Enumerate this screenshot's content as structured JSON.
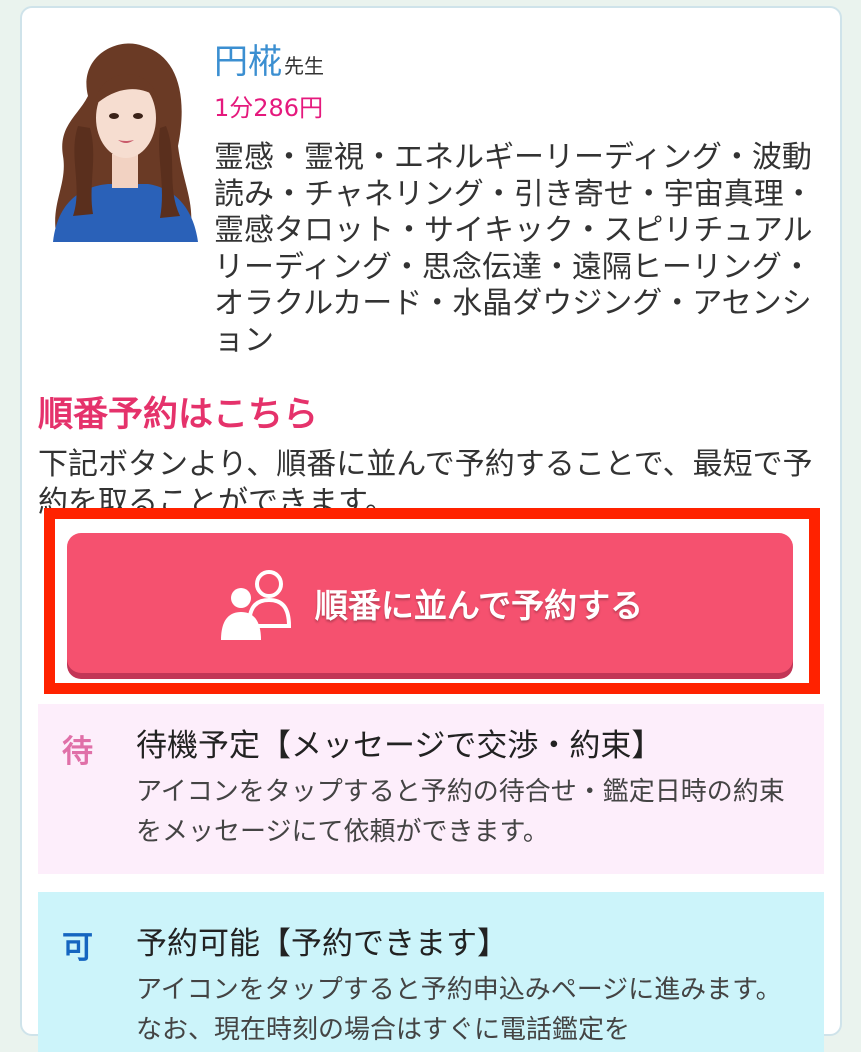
{
  "profile": {
    "name": "円椛",
    "honorific": "先生",
    "price": "1分286円",
    "genres": "霊感・霊視・エネルギーリーディング・波動読み・チャネリング・引き寄せ・宇宙真理・霊感タロット・サイキック・スピリチュアルリーディング・思念伝達・遠隔ヒーリング・オラクルカード・水晶ダウジング・アセンション"
  },
  "reservation": {
    "title": "順番予約はこちら",
    "description": "下記ボタンより、順番に並んで予約することで、最短で予約を取ることができます。",
    "button_label": "順番に並んで予約する",
    "button_icon": "people-icon"
  },
  "status_wait": {
    "badge": "待",
    "title": "待機予定【メッセージで交渉・約束】",
    "text": "アイコンをタップすると予約の待合せ・鑑定日時の約束をメッセージにて依頼ができます。"
  },
  "status_available": {
    "badge": "可",
    "title": "予約可能【予約できます】",
    "text": "アイコンをタップすると予約申込みページに進みます。なお、現在時刻の場合はすぐに電話鑑定を"
  },
  "colors": {
    "name": "#3b8fd1",
    "price": "#e5197d",
    "title": "#e5326b",
    "button": "#f5516f",
    "highlight": "#ff2200"
  }
}
